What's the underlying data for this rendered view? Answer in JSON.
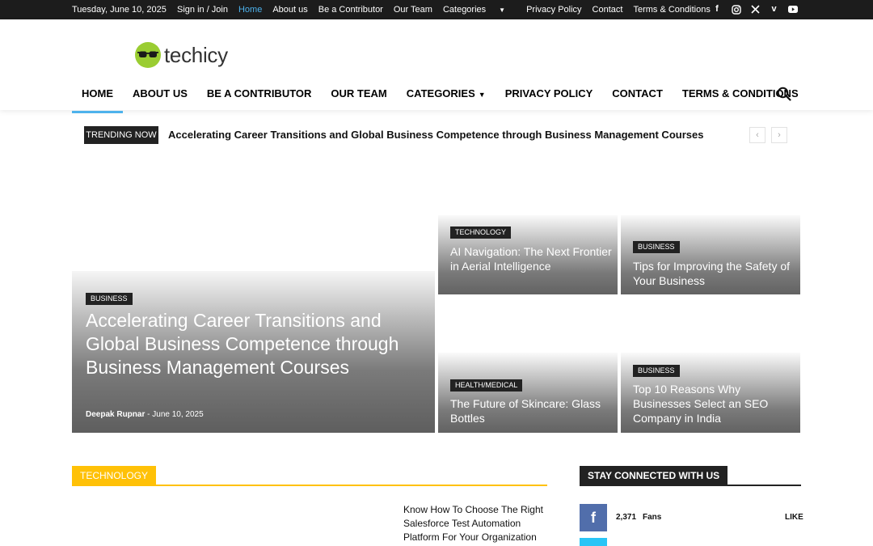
{
  "topbar": {
    "date": "Tuesday, June 10, 2025",
    "links": [
      "Sign in / Join",
      "Home",
      "About us",
      "Be a Contributor",
      "Our Team",
      "Categories",
      "Privacy Policy",
      "Contact",
      "Terms & Conditions"
    ],
    "active_link": "Home",
    "social_icons": [
      "facebook-icon",
      "instagram-icon",
      "x-twitter-icon",
      "vimeo-icon",
      "youtube-icon"
    ]
  },
  "logo": {
    "text": "techicy",
    "color": "#9acd32"
  },
  "nav": {
    "items": [
      "HOME",
      "ABOUT US",
      "BE A CONTRIBUTOR",
      "OUR TEAM",
      "CATEGORIES",
      "PRIVACY POLICY",
      "CONTACT",
      "TERMS & CONDITIONS"
    ],
    "active": "HOME",
    "accent": "#4db2ec"
  },
  "trending": {
    "label": "TRENDING NOW",
    "headline": "Accelerating Career Transitions and Global Business Competence through Business Management Courses"
  },
  "featured": {
    "main": {
      "category": "BUSINESS",
      "title": "Accelerating Career Transitions and Global Business Competence through Business Management Courses",
      "author": "Deepak Rupnar",
      "separator": "-",
      "date": "June 10, 2025"
    },
    "side": [
      {
        "category": "TECHNOLOGY",
        "title": "AI Navigation: The Next Frontier in Aerial Intelligence"
      },
      {
        "category": "BUSINESS",
        "title": "Tips for Improving the Safety of Your Business"
      },
      {
        "category": "HEALTH/MEDICAL",
        "title": "The Future of Skincare: Glass Bottles"
      },
      {
        "category": "BUSINESS",
        "title": "Top 10 Reasons Why Businesses Select an SEO Company in India"
      }
    ]
  },
  "technology_section": {
    "label": "TECHNOLOGY",
    "accent": "#ffc107",
    "article_title": "Know How To Choose The Right Salesforce Test Automation Platform For Your Organization"
  },
  "stay_connected": {
    "label": "STAY CONNECTED WITH US",
    "facebook": {
      "count": "2,371",
      "unit": "Fans",
      "action": "LIKE",
      "color": "#516eab"
    },
    "twitter_color": "#29c5f6"
  }
}
